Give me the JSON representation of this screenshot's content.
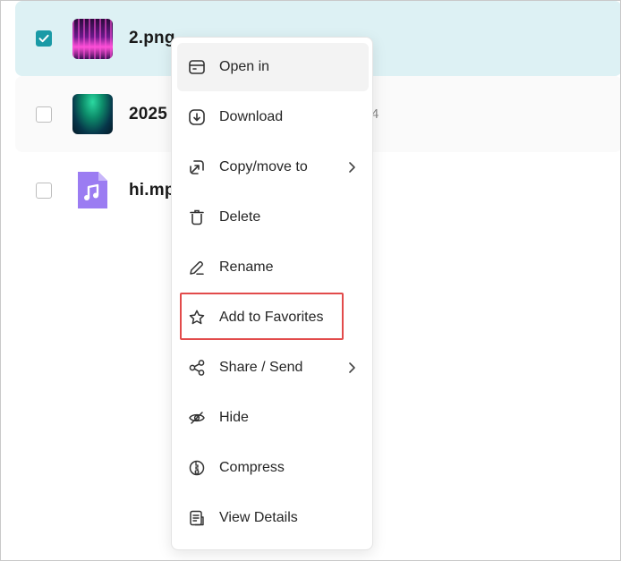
{
  "files": [
    {
      "name": "2.png",
      "selected": true,
      "thumb": "purple-abstract-image",
      "meta": ""
    },
    {
      "name": "2025",
      "selected": false,
      "thumb": "green-aurora-image",
      "meta": "4"
    },
    {
      "name": "hi.mp",
      "selected": false,
      "thumb": "music-file-icon",
      "meta": ""
    }
  ],
  "menu": {
    "items": [
      {
        "id": "open-in",
        "label": "Open in",
        "icon": "open-in-icon",
        "submenu": false
      },
      {
        "id": "download",
        "label": "Download",
        "icon": "download-icon",
        "submenu": false
      },
      {
        "id": "copy-move",
        "label": "Copy/move to",
        "icon": "copy-move-icon",
        "submenu": true
      },
      {
        "id": "delete",
        "label": "Delete",
        "icon": "trash-icon",
        "submenu": false
      },
      {
        "id": "rename",
        "label": "Rename",
        "icon": "pencil-icon",
        "submenu": false
      },
      {
        "id": "add-favorites",
        "label": "Add to Favorites",
        "icon": "star-icon",
        "submenu": false
      },
      {
        "id": "share-send",
        "label": "Share / Send",
        "icon": "share-icon",
        "submenu": true
      },
      {
        "id": "hide",
        "label": "Hide",
        "icon": "eye-slash-icon",
        "submenu": false
      },
      {
        "id": "compress",
        "label": "Compress",
        "icon": "compress-icon",
        "submenu": false
      },
      {
        "id": "view-details",
        "label": "View Details",
        "icon": "details-icon",
        "submenu": false
      }
    ]
  },
  "colors": {
    "selected_row": "#ddf1f4",
    "checkbox_accent": "#1a9aa6",
    "highlight": "#e24b4b",
    "music_icon": "#9b7cf2"
  }
}
